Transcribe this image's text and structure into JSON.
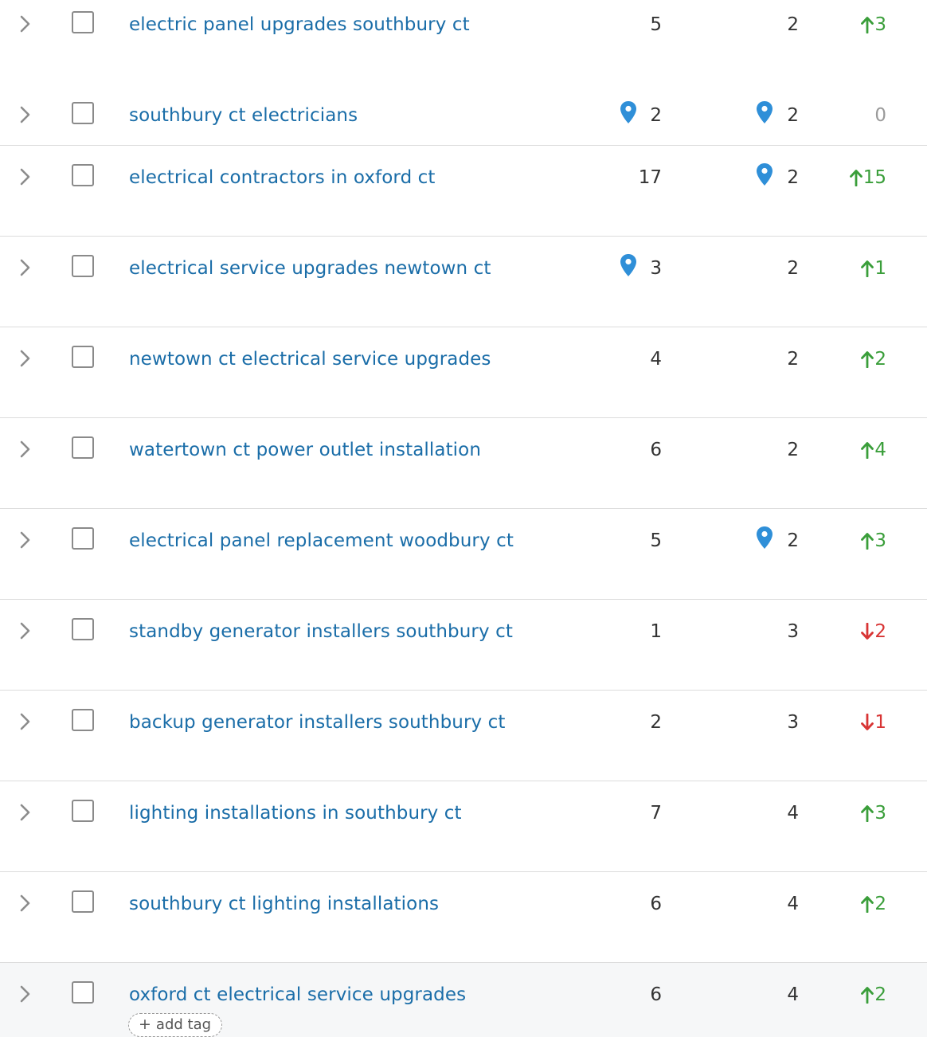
{
  "rows": [
    {
      "keyword": "electric panel upgrades southbury ct",
      "pos1": "5",
      "pos1_pin": false,
      "pos2": "2",
      "pos2_pin": false,
      "change": "3",
      "dir": "up"
    },
    {
      "keyword": "southbury ct electricians",
      "pos1": "2",
      "pos1_pin": true,
      "pos2": "2",
      "pos2_pin": true,
      "change": "0",
      "dir": "flat"
    },
    {
      "keyword": "electrical contractors in oxford ct",
      "pos1": "17",
      "pos1_pin": false,
      "pos2": "2",
      "pos2_pin": true,
      "change": "15",
      "dir": "up"
    },
    {
      "keyword": "electrical service upgrades newtown ct",
      "pos1": "3",
      "pos1_pin": true,
      "pos2": "2",
      "pos2_pin": false,
      "change": "1",
      "dir": "up"
    },
    {
      "keyword": "newtown ct electrical service upgrades",
      "pos1": "4",
      "pos1_pin": false,
      "pos2": "2",
      "pos2_pin": false,
      "change": "2",
      "dir": "up"
    },
    {
      "keyword": "watertown ct power outlet installation",
      "pos1": "6",
      "pos1_pin": false,
      "pos2": "2",
      "pos2_pin": false,
      "change": "4",
      "dir": "up"
    },
    {
      "keyword": "electrical panel replacement woodbury ct",
      "pos1": "5",
      "pos1_pin": false,
      "pos2": "2",
      "pos2_pin": true,
      "change": "3",
      "dir": "up"
    },
    {
      "keyword": "standby generator installers southbury ct",
      "pos1": "1",
      "pos1_pin": false,
      "pos2": "3",
      "pos2_pin": false,
      "change": "2",
      "dir": "down"
    },
    {
      "keyword": "backup generator installers southbury ct",
      "pos1": "2",
      "pos1_pin": false,
      "pos2": "3",
      "pos2_pin": false,
      "change": "1",
      "dir": "down"
    },
    {
      "keyword": "lighting installations in southbury ct",
      "pos1": "7",
      "pos1_pin": false,
      "pos2": "4",
      "pos2_pin": false,
      "change": "3",
      "dir": "up"
    },
    {
      "keyword": "southbury ct lighting installations",
      "pos1": "6",
      "pos1_pin": false,
      "pos2": "4",
      "pos2_pin": false,
      "change": "2",
      "dir": "up"
    },
    {
      "keyword": "oxford ct electrical service upgrades",
      "pos1": "6",
      "pos1_pin": false,
      "pos2": "4",
      "pos2_pin": false,
      "change": "2",
      "dir": "up"
    }
  ],
  "add_tag_label": "add tag",
  "colors": {
    "link": "#1a6da8",
    "up": "#3a9e3a",
    "down": "#d83434",
    "flat": "#9a9a9a",
    "pin": "#2f8fd8"
  },
  "icons": {
    "expand": "chevron-right-icon",
    "location": "map-pin-icon",
    "up": "arrow-up-icon",
    "down": "arrow-down-icon",
    "add": "plus-icon"
  }
}
